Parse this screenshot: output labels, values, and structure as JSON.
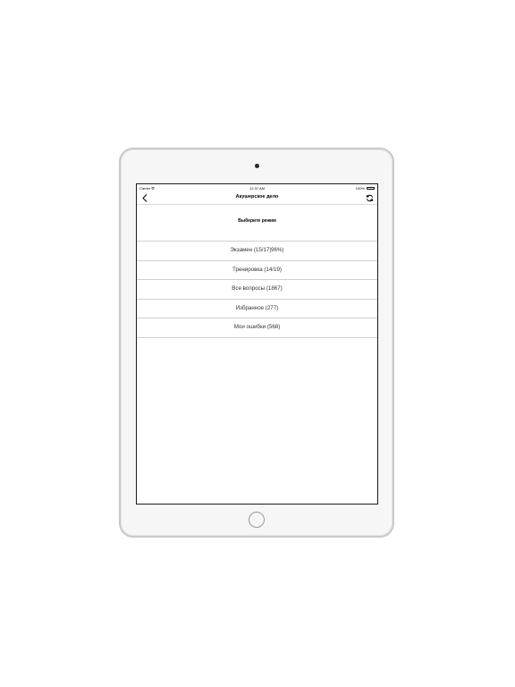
{
  "status_bar": {
    "carrier": "Carrier",
    "time": "12:37 AM",
    "battery": "100%"
  },
  "nav": {
    "title": "Акушерское дело"
  },
  "content": {
    "header": "Выберите режим",
    "items": [
      {
        "label": "Экзамен (15/17|96%)"
      },
      {
        "label": "Тренировка (14/19)"
      },
      {
        "label": "Все вопросы (1867)"
      },
      {
        "label": "Избранное (277)"
      },
      {
        "label": "Мои ошибки (568)"
      }
    ]
  },
  "icons": {
    "back": "chevron-left-icon",
    "refresh": "refresh-icon",
    "wifi": "wifi-icon",
    "battery": "battery-icon"
  },
  "colors": {
    "battery_fill": "#4cd964",
    "device_bezel": "#f6f6f7"
  }
}
